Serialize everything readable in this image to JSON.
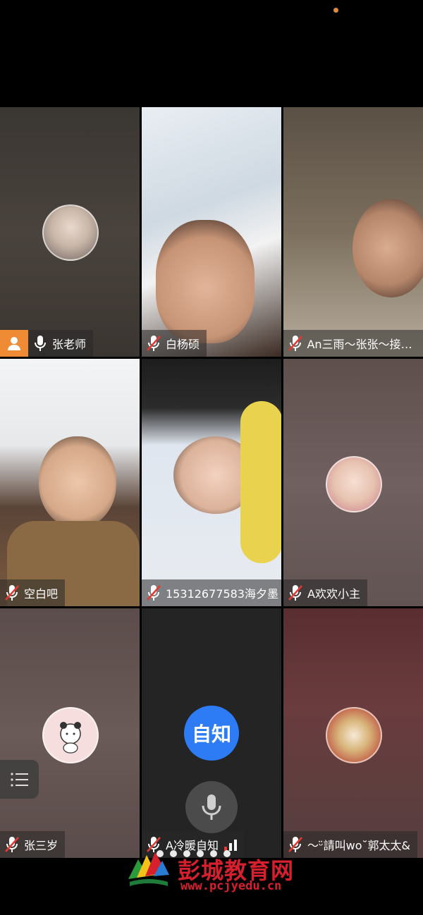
{
  "participants": [
    {
      "name": "张老师",
      "host": true,
      "muted": false
    },
    {
      "name": "白杨硕",
      "muted": true
    },
    {
      "name": "An三雨～张张～接单…",
      "muted": true
    },
    {
      "name": "空白吧",
      "muted": true
    },
    {
      "name": "15312677583海夕墨",
      "muted": true
    },
    {
      "name": "A欢欢小主",
      "muted": true
    },
    {
      "name": "张三岁",
      "muted": true
    },
    {
      "name": "A冷暖自知",
      "muted": true
    },
    {
      "name": "～ᵕ̈請叫wo˘郭太太&",
      "muted": true
    }
  ],
  "self": {
    "avatar_text": "自知"
  },
  "watermark": {
    "title": "彭城教育网",
    "url": "www.pcjyedu.cn"
  },
  "colors": {
    "host_badge": "#ef8a35",
    "self_avatar": "#2d7cf6",
    "watermark": "#d6202e"
  },
  "icons": [
    "person-icon",
    "mic-icon",
    "mic-muted-icon",
    "list-icon",
    "signal-icon"
  ]
}
